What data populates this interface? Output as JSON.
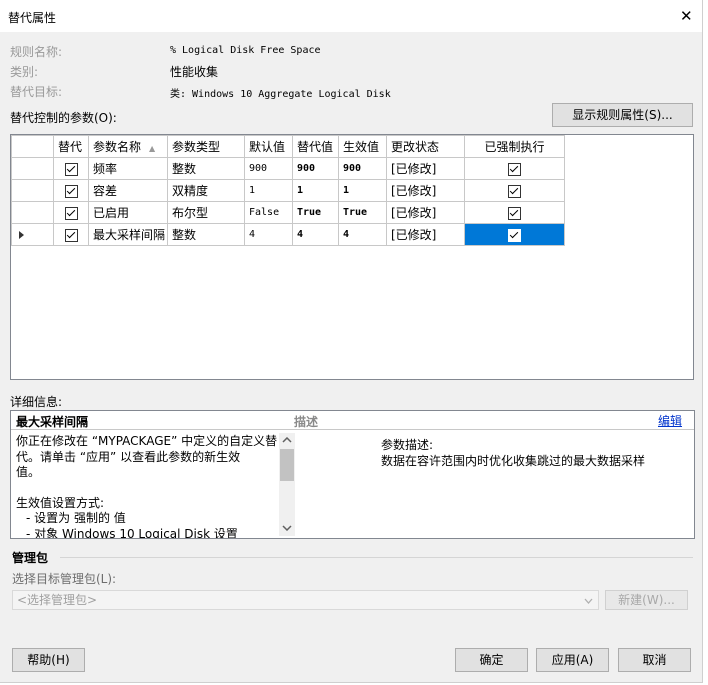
{
  "window": {
    "title": "替代属性",
    "close_glyph": "✕"
  },
  "info": {
    "rule_name_label": "规则名称:",
    "rule_name_value": "% Logical Disk Free Space",
    "category_label": "类别:",
    "category_value": "性能收集",
    "target_label": "替代目标:",
    "target_value": "类: Windows 10 Aggregate Logical Disk"
  },
  "params_label": "替代控制的参数(O):",
  "show_props_button": "显示规则属性(S)...",
  "table": {
    "headers": [
      "替代",
      "参数名称",
      "参数类型",
      "默认值",
      "替代值",
      "生效值",
      "更改状态",
      "已强制执行"
    ],
    "sort_glyph": "▲",
    "rows": [
      {
        "name": "频率",
        "type": "整数",
        "default": "900",
        "override": "900",
        "effective": "900",
        "status": "[已修改]"
      },
      {
        "name": "容差",
        "type": "双精度",
        "default": "1",
        "override": "1",
        "effective": "1",
        "status": "[已修改]"
      },
      {
        "name": "已启用",
        "type": "布尔型",
        "default": "False",
        "override": "True",
        "effective": "True",
        "status": "[已修改]"
      },
      {
        "name": "最大采样间隔",
        "type": "整数",
        "default": "4",
        "override": "4",
        "effective": "4",
        "status": "[已修改]"
      }
    ]
  },
  "details": {
    "label": "详细信息:",
    "title": "最大采样间隔",
    "desc_header": "描述",
    "edit_link": "编辑",
    "body_line1": "你正在修改在 “MYPACKAGE” 中定义的自定义替",
    "body_line2": "代。请单击 “应用” 以查看此参数的新生效",
    "body_line3": "值。",
    "body_line4": "生效值设置方式:",
    "body_line5": "- 设置为 强制的 值",
    "body_line6": "- 对象 Windows 10 Logical Disk 设置",
    "param_desc_label": "参数描述:",
    "param_desc_text": "数据在容许范围内时优化收集跳过的最大数据采样"
  },
  "management": {
    "header": "管理包",
    "select_label": "选择目标管理包(L):",
    "select_placeholder": "<选择管理包>",
    "new_button": "新建(W)..."
  },
  "footer": {
    "help": "帮助(H)",
    "ok": "确定",
    "apply": "应用(A)",
    "cancel": "取消"
  }
}
